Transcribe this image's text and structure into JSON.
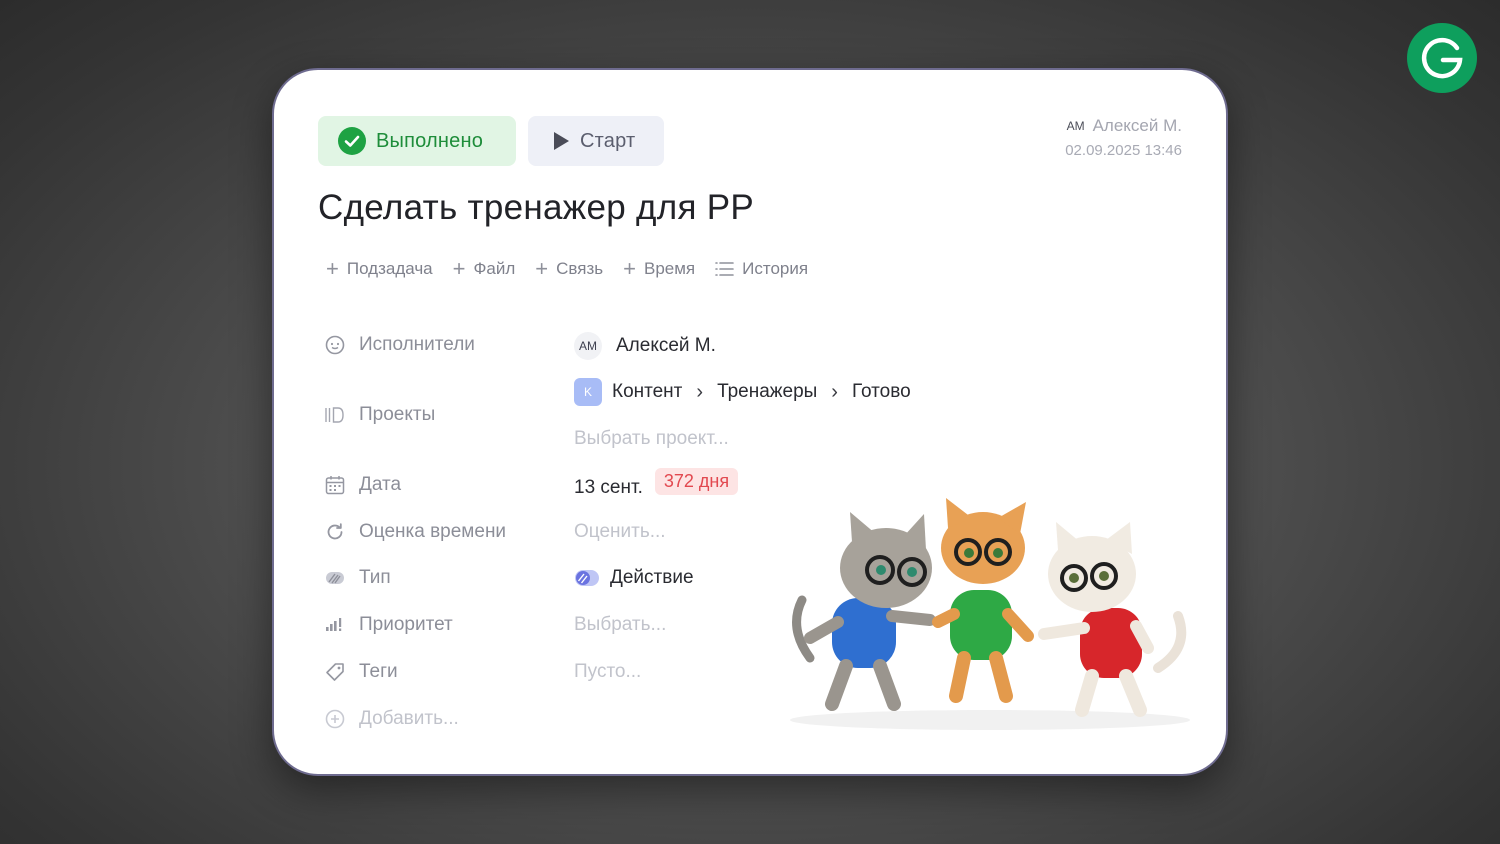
{
  "status": {
    "done_label": "Выполнено",
    "start_label": "Старт"
  },
  "meta": {
    "initials": "AM",
    "user": "Алексей М.",
    "datetime": "02.09.2025 13:46"
  },
  "task": {
    "title": "Сделать тренажер для PP"
  },
  "actions": [
    {
      "label": "Подзадача",
      "icon": "plus-icon"
    },
    {
      "label": "Файл",
      "icon": "plus-icon"
    },
    {
      "label": "Связь",
      "icon": "plus-icon"
    },
    {
      "label": "Время",
      "icon": "plus-icon"
    },
    {
      "label": "История",
      "icon": "list-icon"
    }
  ],
  "fields": {
    "assignees": {
      "label": "Исполнители",
      "initials": "AM",
      "value": "Алексей М."
    },
    "projects": {
      "label": "Проекты",
      "badge": "K",
      "crumbs": [
        "Контент",
        "Тренажеры",
        "Готово"
      ],
      "placeholder": "Выбрать проект..."
    },
    "date": {
      "label": "Дата",
      "value": "13 сент.",
      "badge": "372 дня"
    },
    "estimate": {
      "label": "Оценка времени",
      "placeholder": "Оценить..."
    },
    "type": {
      "label": "Тип",
      "value": "Действие"
    },
    "priority": {
      "label": "Приоритет",
      "placeholder": "Выбрать..."
    },
    "tags": {
      "label": "Теги",
      "placeholder": "Пусто..."
    },
    "add": {
      "label": "Добавить..."
    }
  },
  "colors": {
    "accent_green": "#1e8d3a",
    "logo_green": "#0e9f5d",
    "days_red": "#e2484f",
    "project_badge": "#a8bcf6"
  }
}
